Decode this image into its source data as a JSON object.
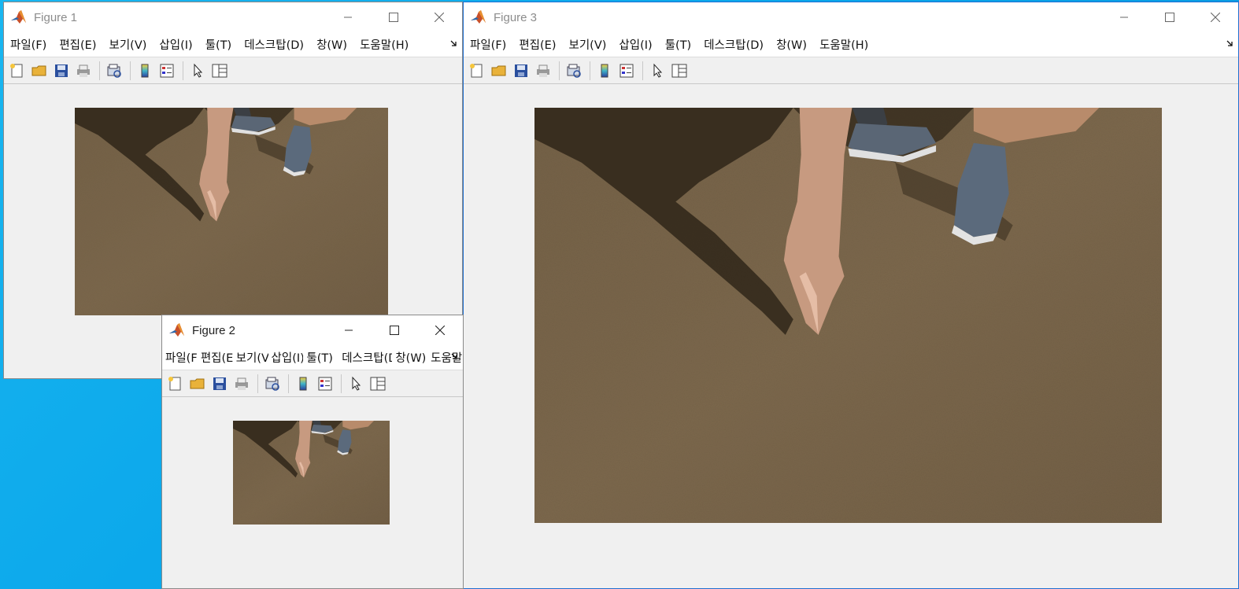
{
  "windows": {
    "fig1": {
      "title": "Figure 1"
    },
    "fig2": {
      "title": "Figure 2"
    },
    "fig3": {
      "title": "Figure 3"
    }
  },
  "menu": {
    "file": "파일(F)",
    "edit": "편집(E)",
    "view": "보기(V)",
    "insert": "삽입(I)",
    "tools": "툴(T)",
    "desktop": "데스크탑(D)",
    "window": "창(W)",
    "help": "도움말(H)"
  },
  "icons": {
    "app": "matlab-icon",
    "minimize": "minimize-icon",
    "maximize": "maximize-icon",
    "close": "close-icon",
    "menu_more": "menu-overflow-icon",
    "toolbar": [
      "new-figure-icon",
      "open-file-icon",
      "save-icon",
      "print-icon",
      "print-preview-icon",
      "colorbar-icon",
      "legend-icon",
      "pointer-icon",
      "property-editor-icon"
    ]
  },
  "colors": {
    "desktop": "#0aa6ea",
    "window_bg": "#f0f0f0",
    "active_border": "#1f6fd1"
  }
}
